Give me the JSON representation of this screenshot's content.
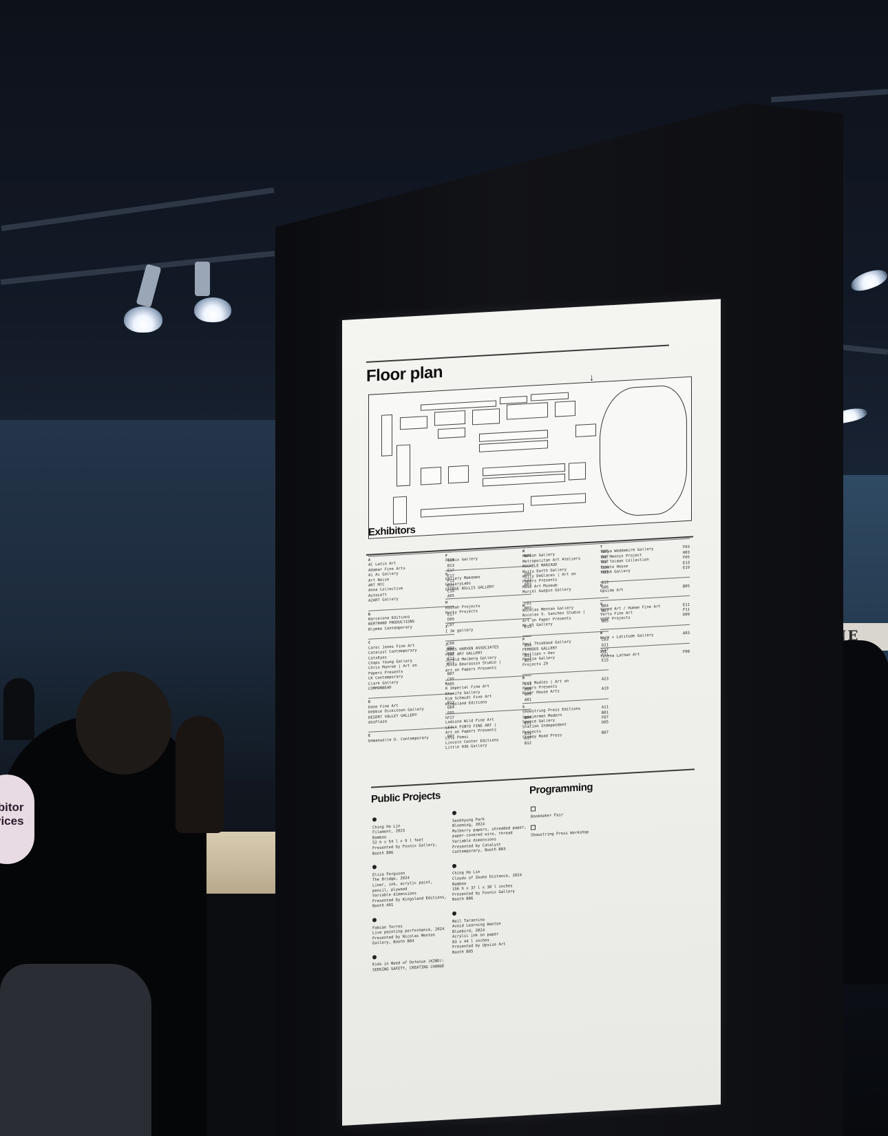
{
  "background": {
    "booth_sign": "NE",
    "round_sign_lines": [
      "ibitor",
      "vices"
    ]
  },
  "poster": {
    "floor_plan": {
      "title": "Floor plan"
    },
    "exhibitors": {
      "title": "Exhibitors",
      "columns": [
        [
          {
            "letter": "A",
            "rows": [
              [
                "AC Latin Art",
                "G15"
              ],
              [
                "Adamar Fine Arts",
                "B13"
              ],
              [
                "Ai Ai Gallery",
                "E17"
              ],
              [
                "Art Noise",
                "E17"
              ],
              [
                "ART MTC",
                "F13"
              ],
              [
                "Anna Collective",
                "E25"
              ],
              [
                "AutoLeft",
                "C19"
              ],
              [
                "A2ART Gallery",
                "A05"
              ]
            ]
          },
          {
            "letter": "B",
            "rows": [
              [
                "Barcelona Editions",
                "E17"
              ],
              [
                "BERTRAND PRODUCTIONS",
                "D05"
              ],
              [
                "Blymke Contemporary",
                "C07"
              ]
            ]
          },
          {
            "letter": "C",
            "rows": [
              [
                "Carol Jones Fine Art",
                "C09"
              ],
              [
                "Catalyst Contemporary",
                "B03"
              ],
              [
                "CatsEyes",
                "B27"
              ],
              [
                "Chaps Young Gallery",
                "F13"
              ],
              [
                "Chris Munroe | Art on",
                "H13"
              ],
              [
                "Papers Presents",
                ""
              ],
              [
                "CK Contemporary",
                "B07"
              ],
              [
                "Clark Gallery",
                "C05"
              ],
              [
                "COMMONBEAD",
                "A05"
              ]
            ]
          },
          {
            "letter": "D",
            "rows": [
              [
                "Dane Fine Art",
                "B12"
              ],
              [
                "Debbie Dickinson Gallery",
                "G04"
              ],
              [
                "DESERT VALLEY GALLERY",
                "F05"
              ],
              [
                "dosPlaza",
                "F17"
              ]
            ]
          },
          {
            "letter": "E",
            "rows": [
              [
                "Emmanuelle D. Contemporary",
                "B07"
              ]
            ]
          }
        ],
        [
          {
            "letter": "F",
            "rows": [
              [
                "Foxnix Gallery",
                "B06"
              ]
            ]
          },
          {
            "letter": "G",
            "rows": [
              [
                "Gallery Makomen",
                "G05"
              ],
              [
                "GalleryLabs",
                "C23"
              ],
              [
                "GEORGE BILLIS GALLERY",
                "B03"
              ]
            ]
          },
          {
            "letter": "H",
            "rows": [
              [
                "Hashan Projects",
                "C01"
              ],
              [
                "Hurty Projects",
                "B03"
              ]
            ]
          },
          {
            "letter": "I",
            "rows": [
              [
                "I 3e gallery",
                "E15"
              ]
            ]
          },
          {
            "letter": "J",
            "rows": [
              [
                "JAMES HARVEN ASSOCIATES",
                "B14"
              ],
              [
                "FINE ART GALLERY",
                ""
              ],
              [
                "Jerald Melberg Gallery",
                "B11"
              ],
              [
                "Julia Bourassin Studio |",
                "B25"
              ],
              [
                "Art on Papers Presents",
                ""
              ]
            ]
          },
          {
            "letter": "K",
            "rows": [
              [
                "K Imperial Fine Art",
                "C11"
              ],
              [
                "Khalifa Gallery",
                "D19"
              ],
              [
                "Kim Schmidt Fine Art",
                "G09"
              ],
              [
                "Kingsland Editions",
                "A01"
              ]
            ]
          },
          {
            "letter": "L",
            "rows": [
              [
                "Ladisna Wild Fine Art",
                "B04"
              ],
              [
                "LEILA PINTO FINE ART |",
                "E21"
              ],
              [
                "Art on Papers Presents",
                ""
              ],
              [
                "Lily Pomsi",
                "B15"
              ],
              [
                "Lincoln Center Editions",
                "A17"
              ],
              [
                "Little 036 Gallery",
                "B12"
              ]
            ]
          }
        ],
        [
          {
            "letter": "M",
            "rows": [
              [
                "Marlon Gallery",
                "B06"
              ],
              [
                "Metropolitan Art Ateliers",
                "B07"
              ],
              [
                "MICHELE MARIAUD",
                "B17"
              ],
              [
                "Multu Earth Gallery",
                "D14"
              ],
              [
                "Molly DeGlaces | Art on",
                "H11"
              ],
              [
                "Papers Presents",
                ""
              ],
              [
                "Muse Art Museum",
                "B19"
              ],
              [
                "Muriel Guepin Gallery",
                "G06"
              ]
            ]
          },
          {
            "letter": "N",
            "rows": [
              [
                "Nicolas Menton Gallery",
                "B04"
              ],
              [
                "Nicolas V. Sanchez Studio |",
                "B07"
              ],
              [
                "Art on Paper Presents",
                ""
              ],
              [
                "NL-US Gallery",
                "B05"
              ]
            ]
          },
          {
            "letter": "P",
            "rows": [
              [
                "Paul Thiebaud Gallery",
                "C03"
              ],
              [
                "PERNOUS GALLERY",
                "D21"
              ],
              [
                "Phillips + Dev",
                "C17"
              ],
              [
                "Portsa Gallery",
                "F11"
              ],
              [
                "Projects 29",
                "E15"
              ]
            ]
          },
          {
            "letter": "R",
            "rows": [
              [
                "Rick Mudles | Art on",
                "A23"
              ],
              [
                "Papers Presents",
                ""
              ],
              [
                "River House Arts",
                "A19"
              ]
            ]
          },
          {
            "letter": "S",
            "rows": [
              [
                "Showstring Press Editions",
                "A11"
              ],
              [
                "Spaniermen Modern",
                "B01"
              ],
              [
                "Spence Gallery",
                "F07"
              ],
              [
                "Station Independent",
                "D05"
              ],
              [
                "Projects",
                ""
              ],
              [
                "Stoney Road Press",
                "B07"
              ]
            ]
          }
        ],
        [
          {
            "letter": "T",
            "rows": [
              [
                "Tanya Weddemire Gallery",
                "F03"
              ],
              [
                "The Mennin Project",
                "H03"
              ],
              [
                "The Tolman Collection",
                "F05"
              ],
              [
                "Tomato House",
                "E13"
              ],
              [
                "TOKKA Gallery",
                "E19"
              ]
            ]
          },
          {
            "letter": "U",
            "rows": [
              [
                "Upside Art",
                "B05"
              ]
            ]
          },
          {
            "letter": "V",
            "rows": [
              [
                "Vered Art / Human Fine Art",
                "E11"
              ],
              [
                "Vertu Fine Art",
                "F11"
              ],
              [
                "VOOP Projects",
                "D09"
              ]
            ]
          },
          {
            "letter": "W",
            "rows": [
              [
                "Work + Latitude Gallery",
                "A03"
              ]
            ]
          },
          {
            "letter": "XYZ",
            "rows": [
              [
                "Yelena Lathan Art",
                "F08"
              ]
            ]
          }
        ]
      ]
    },
    "public_projects": {
      "title": "Public Projects",
      "col1": [
        [
          "Ching Ho Lin",
          "Filament, 2023",
          "Bamboo",
          "52 h x 54 l x 9 l feet",
          "Presented by Foxnix Gallery,",
          "Booth B06"
        ],
        [
          "Eliza Ferguson",
          "The Bridge, 2024",
          "Liner, ink, acrylic paint,",
          "pencil, plywood",
          "Variable dimensions",
          "Presented by Kingsland Editions,",
          "Booth A01"
        ],
        [
          "Fabian Torres",
          "Live painting performance, 2024",
          "Presented by Nicolas Menton",
          "Gallery, Booth B04"
        ],
        [
          "Kids in Need of Defense (KIND):",
          "SEEKING SAFETY, CREATING CHANGE"
        ]
      ],
      "col2": [
        [
          "Seokhyung Park",
          "Blooming, 2024",
          "Mulberry papers, shredded paper,",
          "paper-covered wire, thread",
          "Variable dimensions",
          "Presented by Catalyst",
          "Contemporary, Booth B03"
        ],
        [
          "Ching Ho Lin",
          "Clouds of Zeuko Distance, 2024",
          "Bamboo",
          "156 h x 37 l x 30 l inches",
          "Presented by Foxnix Gallery",
          "Booth B06"
        ],
        [
          "Neil Tarantino",
          "Avoid Learning Wanton",
          "Bluebird, 2024",
          "Acrylic ink on paper",
          "83 x 44 l inches",
          "Presented by Upsize Art",
          "Booth B05"
        ]
      ]
    },
    "programming": {
      "title": "Programming",
      "items": [
        "Bookmaker Fair",
        "Showstring Press Workshop"
      ]
    }
  }
}
